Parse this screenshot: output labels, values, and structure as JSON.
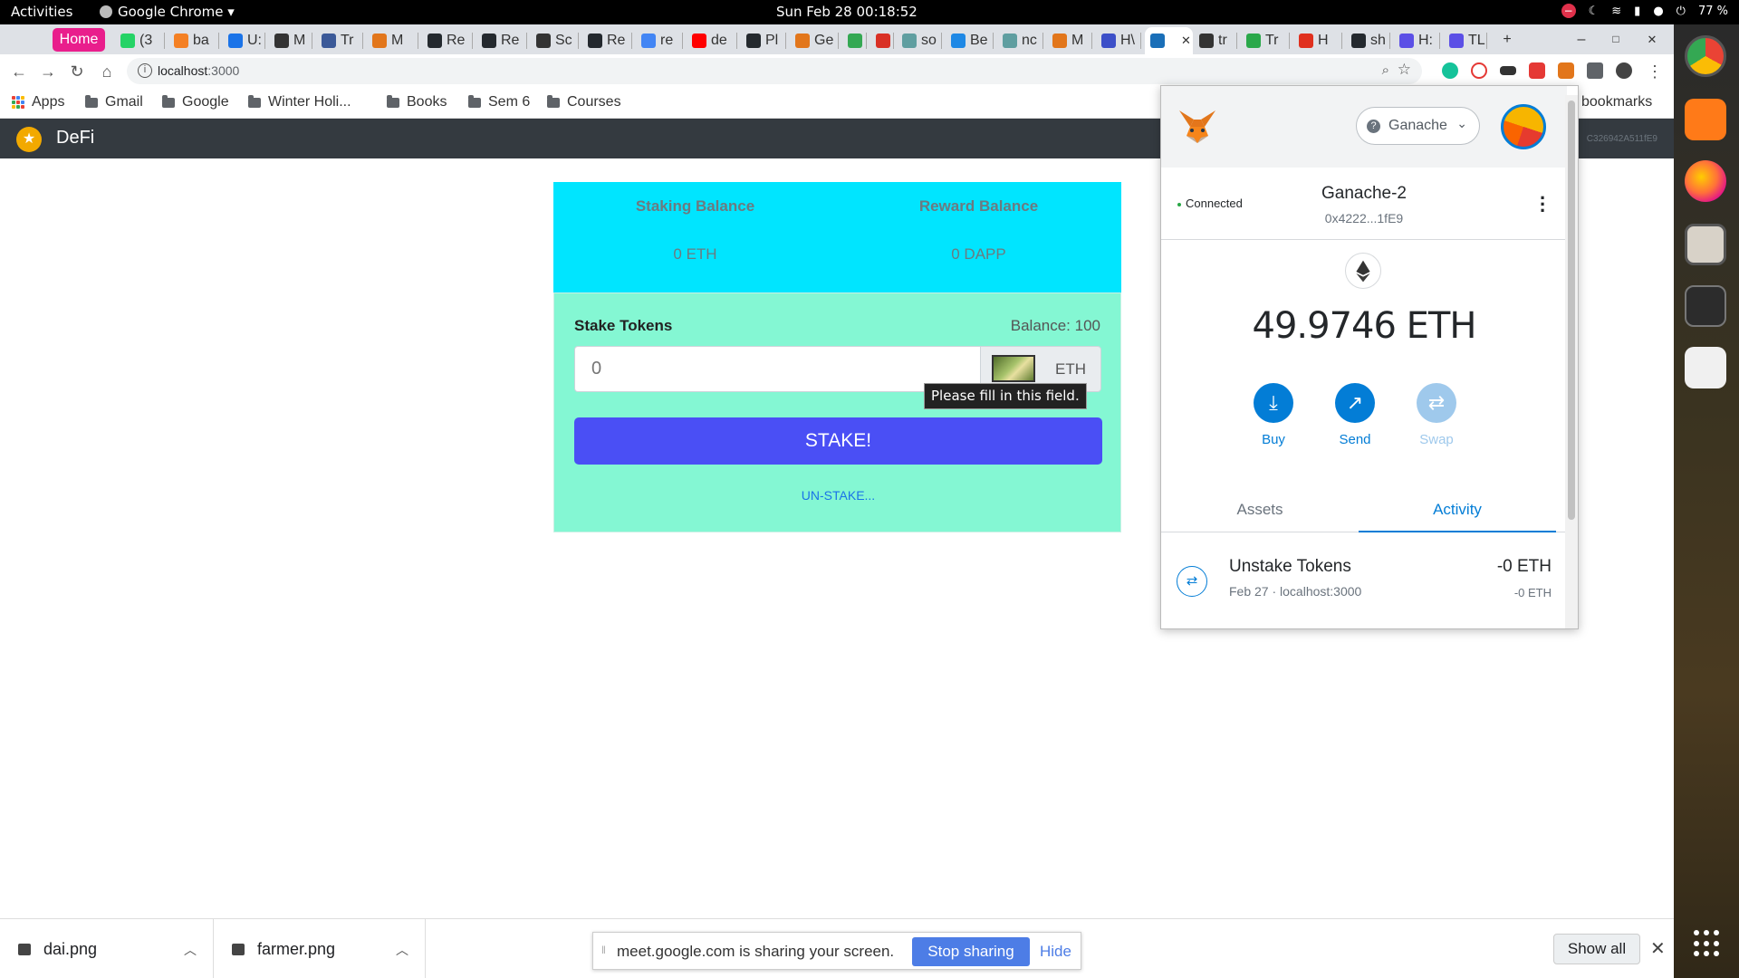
{
  "os_bar": {
    "activities": "Activities",
    "app_name": "Google Chrome ▾",
    "clock": "Sun Feb 28  00:18:52",
    "battery": "77 %"
  },
  "tabs": [
    {
      "label": "Home",
      "color": "#e91e8c"
    },
    {
      "label": "(3",
      "color": "#25d366"
    },
    {
      "label": "ba",
      "color": "#f48024"
    },
    {
      "label": "U:",
      "color": "#1a73e8"
    },
    {
      "label": "M",
      "color": "#333333"
    },
    {
      "label": "Tr",
      "color": "#3b5998"
    },
    {
      "label": "M",
      "color": "#e2761b"
    },
    {
      "label": "Re",
      "color": "#24292e"
    },
    {
      "label": "Re",
      "color": "#24292e"
    },
    {
      "label": "Sc",
      "color": "#333333"
    },
    {
      "label": "Re",
      "color": "#24292e"
    },
    {
      "label": "re",
      "color": "#4285f4"
    },
    {
      "label": "de",
      "color": "#ff0000"
    },
    {
      "label": "Pl",
      "color": "#24292e"
    },
    {
      "label": "Ge",
      "color": "#e2761b"
    },
    {
      "label": "",
      "color": "#34a853"
    },
    {
      "label": "",
      "color": "#d93025"
    },
    {
      "label": "so",
      "color": "#5f9ea0"
    },
    {
      "label": "Be",
      "color": "#1e88e5"
    },
    {
      "label": "nc",
      "color": "#5f9ea0"
    },
    {
      "label": "M",
      "color": "#e2761b"
    },
    {
      "label": "H\\",
      "color": "#3c4fc8"
    },
    {
      "label": "",
      "color": "#1a6fb8"
    },
    {
      "label": "tr",
      "color": "#333333"
    },
    {
      "label": "Tr",
      "color": "#2aa84a"
    },
    {
      "label": "H",
      "color": "#e0301e"
    },
    {
      "label": "sh",
      "color": "#24292e"
    },
    {
      "label": "H:",
      "color": "#5b4fe6"
    },
    {
      "label": "TL",
      "color": "#5b4fe6"
    }
  ],
  "window_controls": {
    "new_tab": "+",
    "minimize": "–",
    "maximize": "□",
    "close": "✕",
    "tab_close": "✕"
  },
  "address_bar": {
    "url_host": "localhost",
    "url_port": ":3000"
  },
  "bookmarks": {
    "items": [
      "Apps",
      "Gmail",
      "Google",
      "Winter Holi...",
      "Books",
      "Sem 6",
      "Courses"
    ],
    "other": "bookmarks"
  },
  "app": {
    "brand": "DeFi",
    "account_fragment": "C326942A511fE9"
  },
  "dashboard": {
    "staking_balance_label": "Staking Balance",
    "reward_balance_label": "Reward Balance",
    "staking_balance_value": "0 ETH",
    "reward_balance_value": "0 DAPP"
  },
  "stake_form": {
    "title": "Stake Tokens",
    "balance": "Balance: 100",
    "input_placeholder": "0",
    "token_symbol": "ETH",
    "validation_tooltip": "Please fill in this field.",
    "stake_button": "STAKE!",
    "unstake_link": "UN-STAKE..."
  },
  "metamask": {
    "network": "Ganache",
    "connection_status": "Connected",
    "account_name": "Ganache-2",
    "account_address": "0x4222...1fE9",
    "balance": "49.9746 ETH",
    "actions": [
      {
        "label": "Buy",
        "enabled": true
      },
      {
        "label": "Send",
        "enabled": true
      },
      {
        "label": "Swap",
        "enabled": false
      }
    ],
    "tabs": [
      "Assets",
      "Activity"
    ],
    "active_tab": "Activity",
    "transactions": [
      {
        "title": "Unstake Tokens",
        "subtitle": "Feb 27 · localhost:3000",
        "amount": "-0 ETH",
        "fiat": "-0 ETH"
      }
    ]
  },
  "downloads": {
    "items": [
      "dai.png",
      "farmer.png"
    ],
    "show_all": "Show all"
  },
  "screen_share": {
    "message": "meet.google.com is sharing your screen.",
    "stop_button": "Stop sharing",
    "hide_button": "Hide"
  }
}
